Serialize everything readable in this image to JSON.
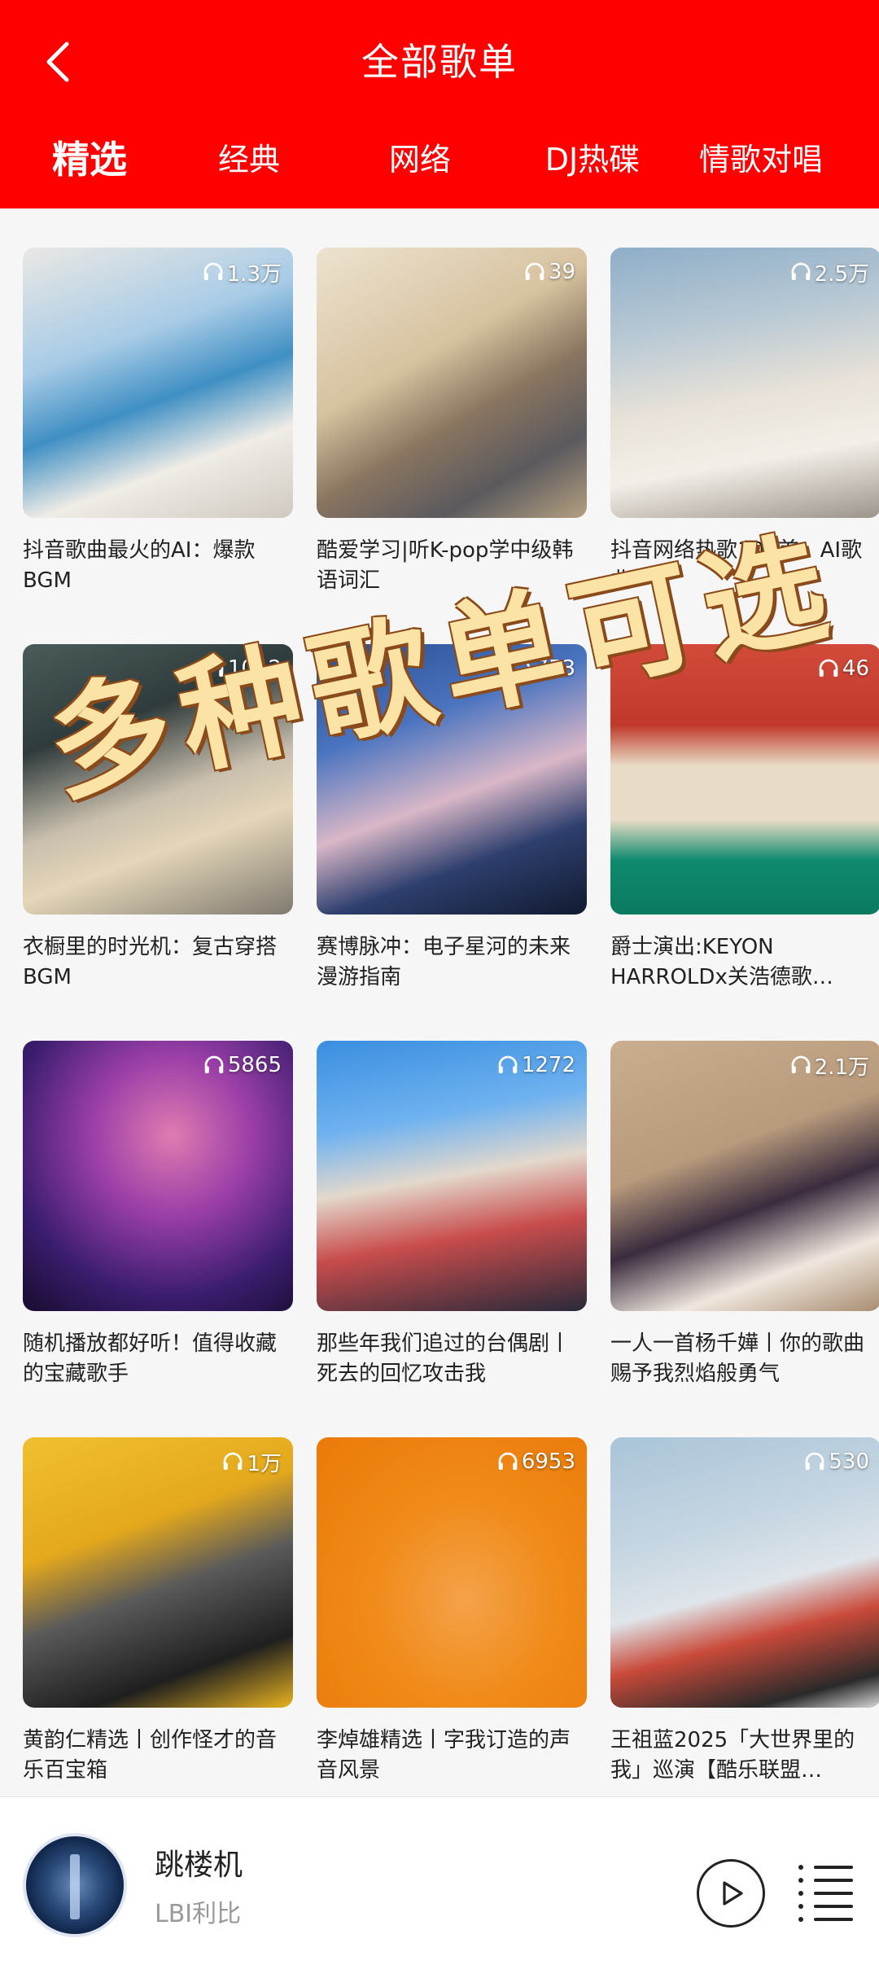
{
  "header": {
    "title": "全部歌单",
    "tabs": [
      {
        "label": "精选",
        "active": true
      },
      {
        "label": "经典",
        "active": false
      },
      {
        "label": "网络",
        "active": false
      },
      {
        "label": "DJ热碟",
        "active": false
      },
      {
        "label": "情歌对唱",
        "active": false
      }
    ]
  },
  "playlists": [
    {
      "count": "1.3万",
      "title": "抖音歌曲最火的AI：爆款BGM"
    },
    {
      "count": "39",
      "title": "酷爱学习|听K-pop学中级韩语词汇"
    },
    {
      "count": "2.5万",
      "title": "抖音网络热歌100首：AI歌曲"
    },
    {
      "count": "1012",
      "title": "衣橱里的时光机：复古穿搭 BGM"
    },
    {
      "count": "753",
      "title": "赛博脉冲：电子星河的未来漫游指南"
    },
    {
      "count": "46",
      "title": "爵士演出:KEYON HARROLDx关浩德歌…"
    },
    {
      "count": "5865",
      "title": "随机播放都好听！值得收藏的宝藏歌手"
    },
    {
      "count": "1272",
      "title": "那些年我们追过的台偶剧丨死去的回忆攻击我"
    },
    {
      "count": "2.1万",
      "title": "一人一首杨千嬅丨你的歌曲赐予我烈焰般勇气"
    },
    {
      "count": "1万",
      "title": "黄韵仁精选丨创作怪才的音乐百宝箱"
    },
    {
      "count": "6953",
      "title": "李焯雄精选丨字我订造的声音风景"
    },
    {
      "count": "530",
      "title": "王祖蓝2025「大世界里的我」巡演【酷乐联盟…"
    }
  ],
  "overlay_text": "多种歌单可选",
  "player": {
    "song": "跳楼机",
    "artist": "LBI利比"
  },
  "colors": {
    "accent": "#ff0000"
  }
}
